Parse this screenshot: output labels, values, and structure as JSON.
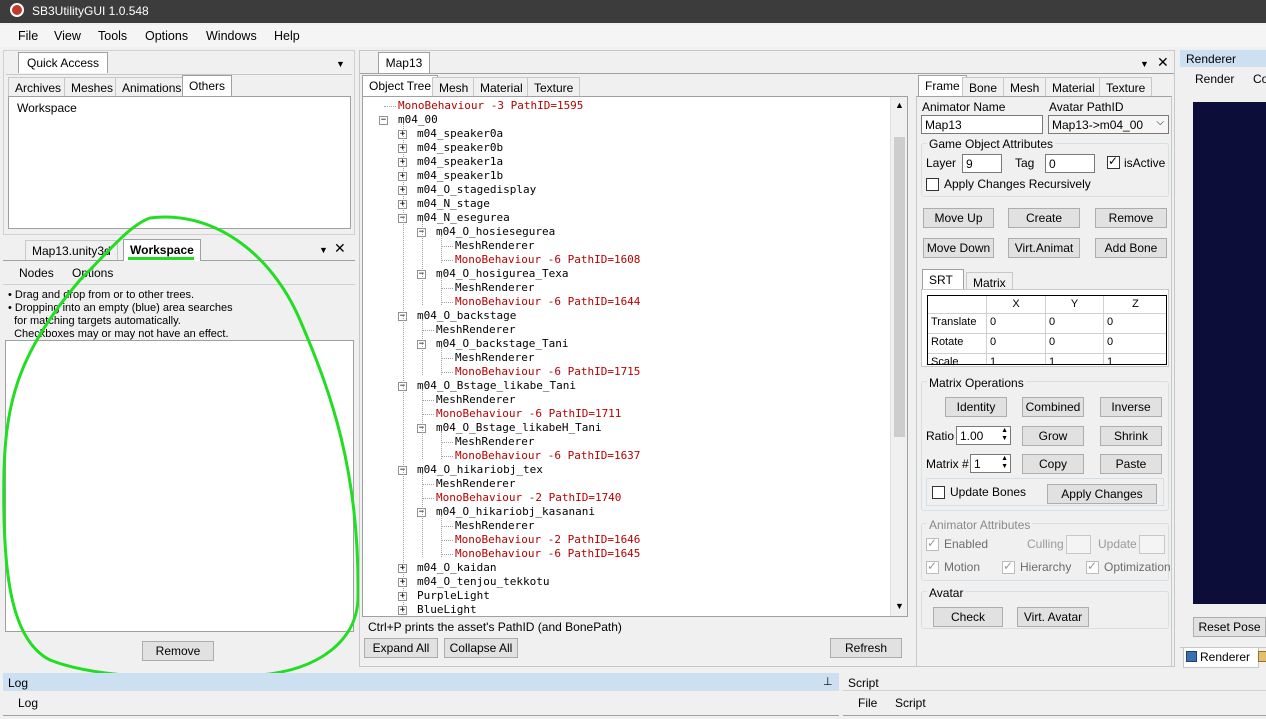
{
  "window": {
    "title": "SB3UtilityGUI 1.0.548"
  },
  "menu": [
    "File",
    "View",
    "Tools",
    "Options",
    "Windows",
    "Help"
  ],
  "quick_access": {
    "title": "Quick Access",
    "tabs": [
      "Archives",
      "Meshes",
      "Animations",
      "Others"
    ],
    "active_tab": "Others",
    "items": [
      "Workspace"
    ]
  },
  "workspace_panel": {
    "tabs": [
      "Map13.unity3d",
      "Workspace"
    ],
    "active_tab": "Workspace",
    "sub_tabs": [
      "Nodes",
      "Options"
    ],
    "help": [
      "• Drag and drop from or to other trees.",
      "• Dropping into an empty (blue) area searches",
      "  for matching targets automatically.",
      "  Checkboxes may or may not have an effect."
    ],
    "remove_label": "Remove"
  },
  "map_panel": {
    "title": "Map13",
    "tabs": [
      "Object Tree",
      "Mesh",
      "Material",
      "Texture"
    ],
    "active_tab": "Object Tree",
    "tree": [
      {
        "t": "MonoBehaviour -3 PathID=1595",
        "d": 1,
        "red": true,
        "exp": null
      },
      {
        "t": "m04_00",
        "d": 1,
        "red": false,
        "exp": "-"
      },
      {
        "t": "m04_speaker0a",
        "d": 2,
        "red": false,
        "exp": "+"
      },
      {
        "t": "m04_speaker0b",
        "d": 2,
        "red": false,
        "exp": "+"
      },
      {
        "t": "m04_speaker1a",
        "d": 2,
        "red": false,
        "exp": "+"
      },
      {
        "t": "m04_speaker1b",
        "d": 2,
        "red": false,
        "exp": "+"
      },
      {
        "t": "m04_O_stagedisplay",
        "d": 2,
        "red": false,
        "exp": "+"
      },
      {
        "t": "m04_N_stage",
        "d": 2,
        "red": false,
        "exp": "+"
      },
      {
        "t": "m04_N_esegurea",
        "d": 2,
        "red": false,
        "exp": "-"
      },
      {
        "t": "m04_O_hosiesegurea",
        "d": 3,
        "red": false,
        "exp": "-"
      },
      {
        "t": "MeshRenderer",
        "d": 4,
        "red": false,
        "exp": null
      },
      {
        "t": "MonoBehaviour -6 PathID=1608",
        "d": 4,
        "red": true,
        "exp": null
      },
      {
        "t": "m04_O_hosigurea_Texa",
        "d": 3,
        "red": false,
        "exp": "-"
      },
      {
        "t": "MeshRenderer",
        "d": 4,
        "red": false,
        "exp": null
      },
      {
        "t": "MonoBehaviour -6 PathID=1644",
        "d": 4,
        "red": true,
        "exp": null
      },
      {
        "t": "m04_O_backstage",
        "d": 2,
        "red": false,
        "exp": "-"
      },
      {
        "t": "MeshRenderer",
        "d": 3,
        "red": false,
        "exp": null
      },
      {
        "t": "m04_O_backstage_Tani",
        "d": 3,
        "red": false,
        "exp": "-"
      },
      {
        "t": "MeshRenderer",
        "d": 4,
        "red": false,
        "exp": null
      },
      {
        "t": "MonoBehaviour -6 PathID=1715",
        "d": 4,
        "red": true,
        "exp": null
      },
      {
        "t": "m04_O_Bstage_likabe_Tani",
        "d": 2,
        "red": false,
        "exp": "-"
      },
      {
        "t": "MeshRenderer",
        "d": 3,
        "red": false,
        "exp": null
      },
      {
        "t": "MonoBehaviour -6 PathID=1711",
        "d": 3,
        "red": true,
        "exp": null
      },
      {
        "t": "m04_O_Bstage_likabeH_Tani",
        "d": 3,
        "red": false,
        "exp": "-"
      },
      {
        "t": "MeshRenderer",
        "d": 4,
        "red": false,
        "exp": null
      },
      {
        "t": "MonoBehaviour -6 PathID=1637",
        "d": 4,
        "red": true,
        "exp": null
      },
      {
        "t": "m04_O_hikariobj_tex",
        "d": 2,
        "red": false,
        "exp": "-"
      },
      {
        "t": "MeshRenderer",
        "d": 3,
        "red": false,
        "exp": null
      },
      {
        "t": "MonoBehaviour -2 PathID=1740",
        "d": 3,
        "red": true,
        "exp": null
      },
      {
        "t": "m04_O_hikariobj_kasanani",
        "d": 3,
        "red": false,
        "exp": "-"
      },
      {
        "t": "MeshRenderer",
        "d": 4,
        "red": false,
        "exp": null
      },
      {
        "t": "MonoBehaviour -2 PathID=1646",
        "d": 4,
        "red": true,
        "exp": null
      },
      {
        "t": "MonoBehaviour -6 PathID=1645",
        "d": 4,
        "red": true,
        "exp": null
      },
      {
        "t": "m04_O_kaidan",
        "d": 2,
        "red": false,
        "exp": "+"
      },
      {
        "t": "m04_O_tenjou_tekkotu",
        "d": 2,
        "red": false,
        "exp": "+"
      },
      {
        "t": "PurpleLight",
        "d": 2,
        "red": false,
        "exp": "+"
      },
      {
        "t": "BlueLight",
        "d": 2,
        "red": false,
        "exp": "+"
      }
    ],
    "hint": "Ctrl+P prints the asset's PathID (and BonePath)",
    "expand_all": "Expand All",
    "collapse_all": "Collapse All",
    "refresh": "Refresh"
  },
  "frame_panel": {
    "tabs": [
      "Frame",
      "Bone",
      "Mesh",
      "Material",
      "Texture"
    ],
    "active_tab": "Frame",
    "animator_name_label": "Animator Name",
    "animator_name": "Map13",
    "avatar_pathid_label": "Avatar PathID",
    "avatar_pathid": "Map13->m04_00",
    "goa_title": "Game Object Attributes",
    "layer_label": "Layer",
    "layer": "9",
    "tag_label": "Tag",
    "tag": "0",
    "isactive_label": "isActive",
    "apply_recursive": "Apply Changes Recursively",
    "buttons": {
      "move_up": "Move Up",
      "create": "Create",
      "remove": "Remove",
      "move_down": "Move Down",
      "virt_animat": "Virt.Animat",
      "add_bone": "Add Bone"
    },
    "srt_tabs": [
      "SRT",
      "Matrix"
    ],
    "srt_columns": [
      "",
      "X",
      "Y",
      "Z"
    ],
    "srt_rows": [
      [
        "Translate",
        "0",
        "0",
        "0"
      ],
      [
        "Rotate",
        "0",
        "0",
        "0"
      ],
      [
        "Scale",
        "1",
        "1",
        "1"
      ]
    ],
    "matrix_ops": {
      "title": "Matrix Operations",
      "identity": "Identity",
      "combined": "Combined",
      "inverse": "Inverse",
      "ratio_label": "Ratio",
      "ratio": "1.00",
      "grow": "Grow",
      "shrink": "Shrink",
      "matrix_label": "Matrix #",
      "matrix": "1",
      "copy": "Copy",
      "paste": "Paste",
      "update_bones": "Update Bones",
      "apply_changes": "Apply Changes"
    },
    "animator_attrs": {
      "title": "Animator Attributes",
      "enabled": "Enabled",
      "culling": "Culling",
      "update": "Update",
      "motion": "Motion",
      "hierarchy": "Hierarchy",
      "optimization": "Optimization"
    },
    "avatar": {
      "title": "Avatar",
      "check": "Check",
      "virt_avatar": "Virt. Avatar"
    }
  },
  "renderer": {
    "title": "Renderer",
    "tabs": [
      "Render",
      "Co"
    ],
    "reset_pose": "Reset Pose",
    "bottom_tab": "Renderer",
    "viewport_color": "#0d0d3a"
  },
  "log": {
    "title": "Log",
    "tab": "Log"
  },
  "script": {
    "title": "Script",
    "menu": [
      "File",
      "Script"
    ]
  },
  "colors": {
    "annotation": "#22dd22",
    "red_text": "#b80000"
  }
}
